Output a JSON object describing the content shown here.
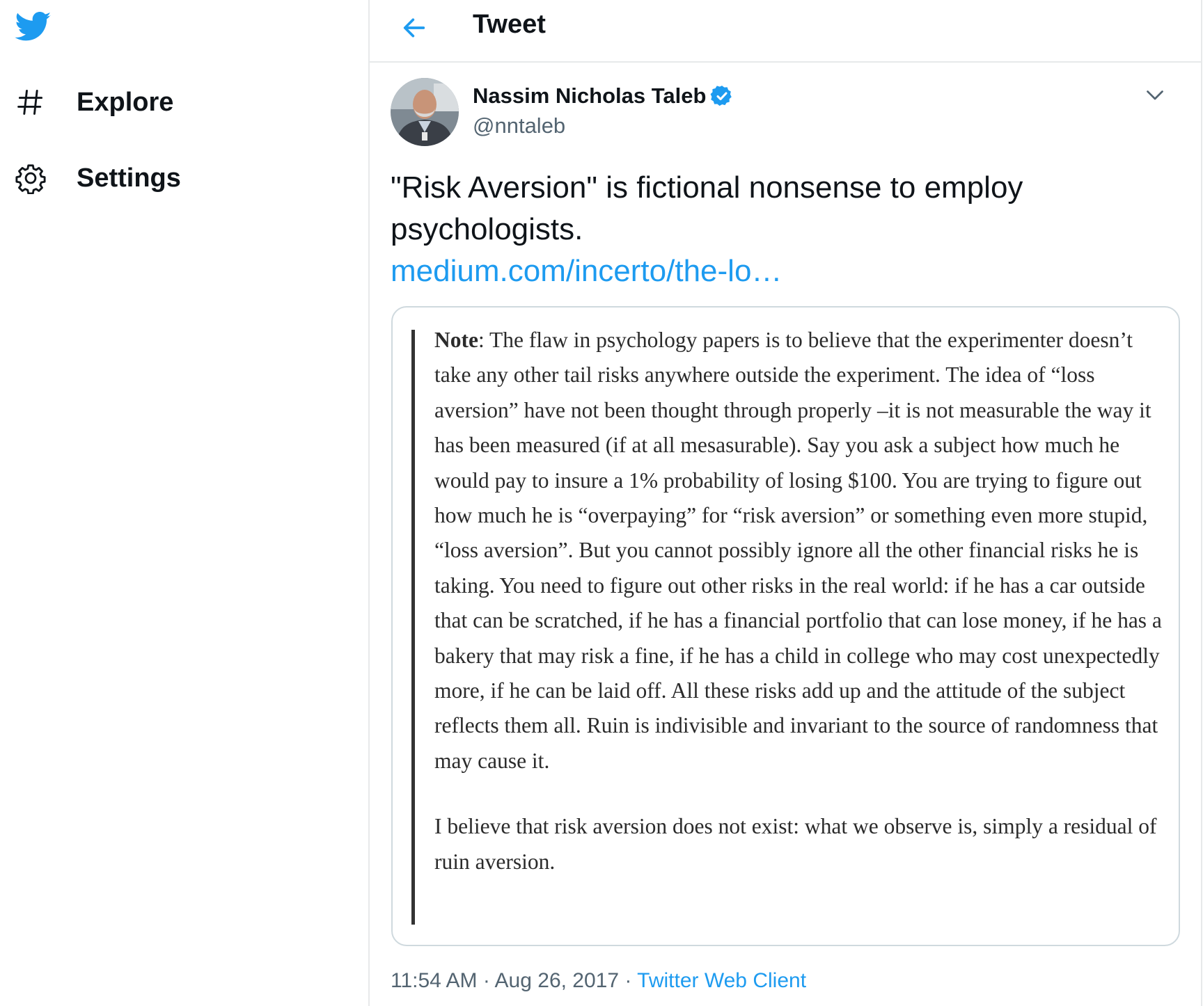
{
  "sidebar": {
    "logo_icon": "twitter-bird-icon",
    "items": [
      {
        "label": "Explore",
        "icon": "hashtag-icon"
      },
      {
        "label": "Settings",
        "icon": "gear-icon"
      }
    ]
  },
  "header": {
    "back_icon": "back-arrow-icon",
    "title": "Tweet"
  },
  "tweet": {
    "author": {
      "name": "Nassim Nicholas Taleb",
      "handle": "@nntaleb",
      "verified": true
    },
    "text": "\"Risk Aversion\" is fictional nonsense to employ psychologists.",
    "link": "medium.com/incerto/the-lo…",
    "card": {
      "note_label": "Note",
      "paragraph1_rest": ": The flaw in psychology papers is to believe that the experimenter doesn’t take any other tail risks anywhere outside the experiment. The idea of “loss aversion” have not been thought through properly –it is not measurable the way it has been measured (if at all mesasurable). Say you ask a subject how much he would pay to insure a 1% probability of losing $100. You are trying to figure out how much he is “overpaying” for “risk aversion” or something even more stupid, “loss aversion”. But you cannot possibly ignore all the other financial risks he is taking. You need to figure out other risks in the real world: if he has a car outside that can be scratched, if he has a financial portfolio that can lose money, if he has a bakery that may risk a fine, if he has a child in college who may cost unexpectedly more, if he can be laid off. All these risks add up and the attitude of the subject reflects them all. Ruin is indivisible and invariant to the source of randomness that may cause it.",
      "paragraph2": "I believe that risk aversion does not exist: what we observe is, simply a residual of ruin aversion."
    },
    "time": "11:54 AM",
    "date": "Aug 26, 2017",
    "client": "Twitter Web Client",
    "separator": " · "
  },
  "colors": {
    "accent": "#1d9bf0",
    "text": "#0f1419",
    "muted": "#536471",
    "border": "#e7e9ea"
  }
}
